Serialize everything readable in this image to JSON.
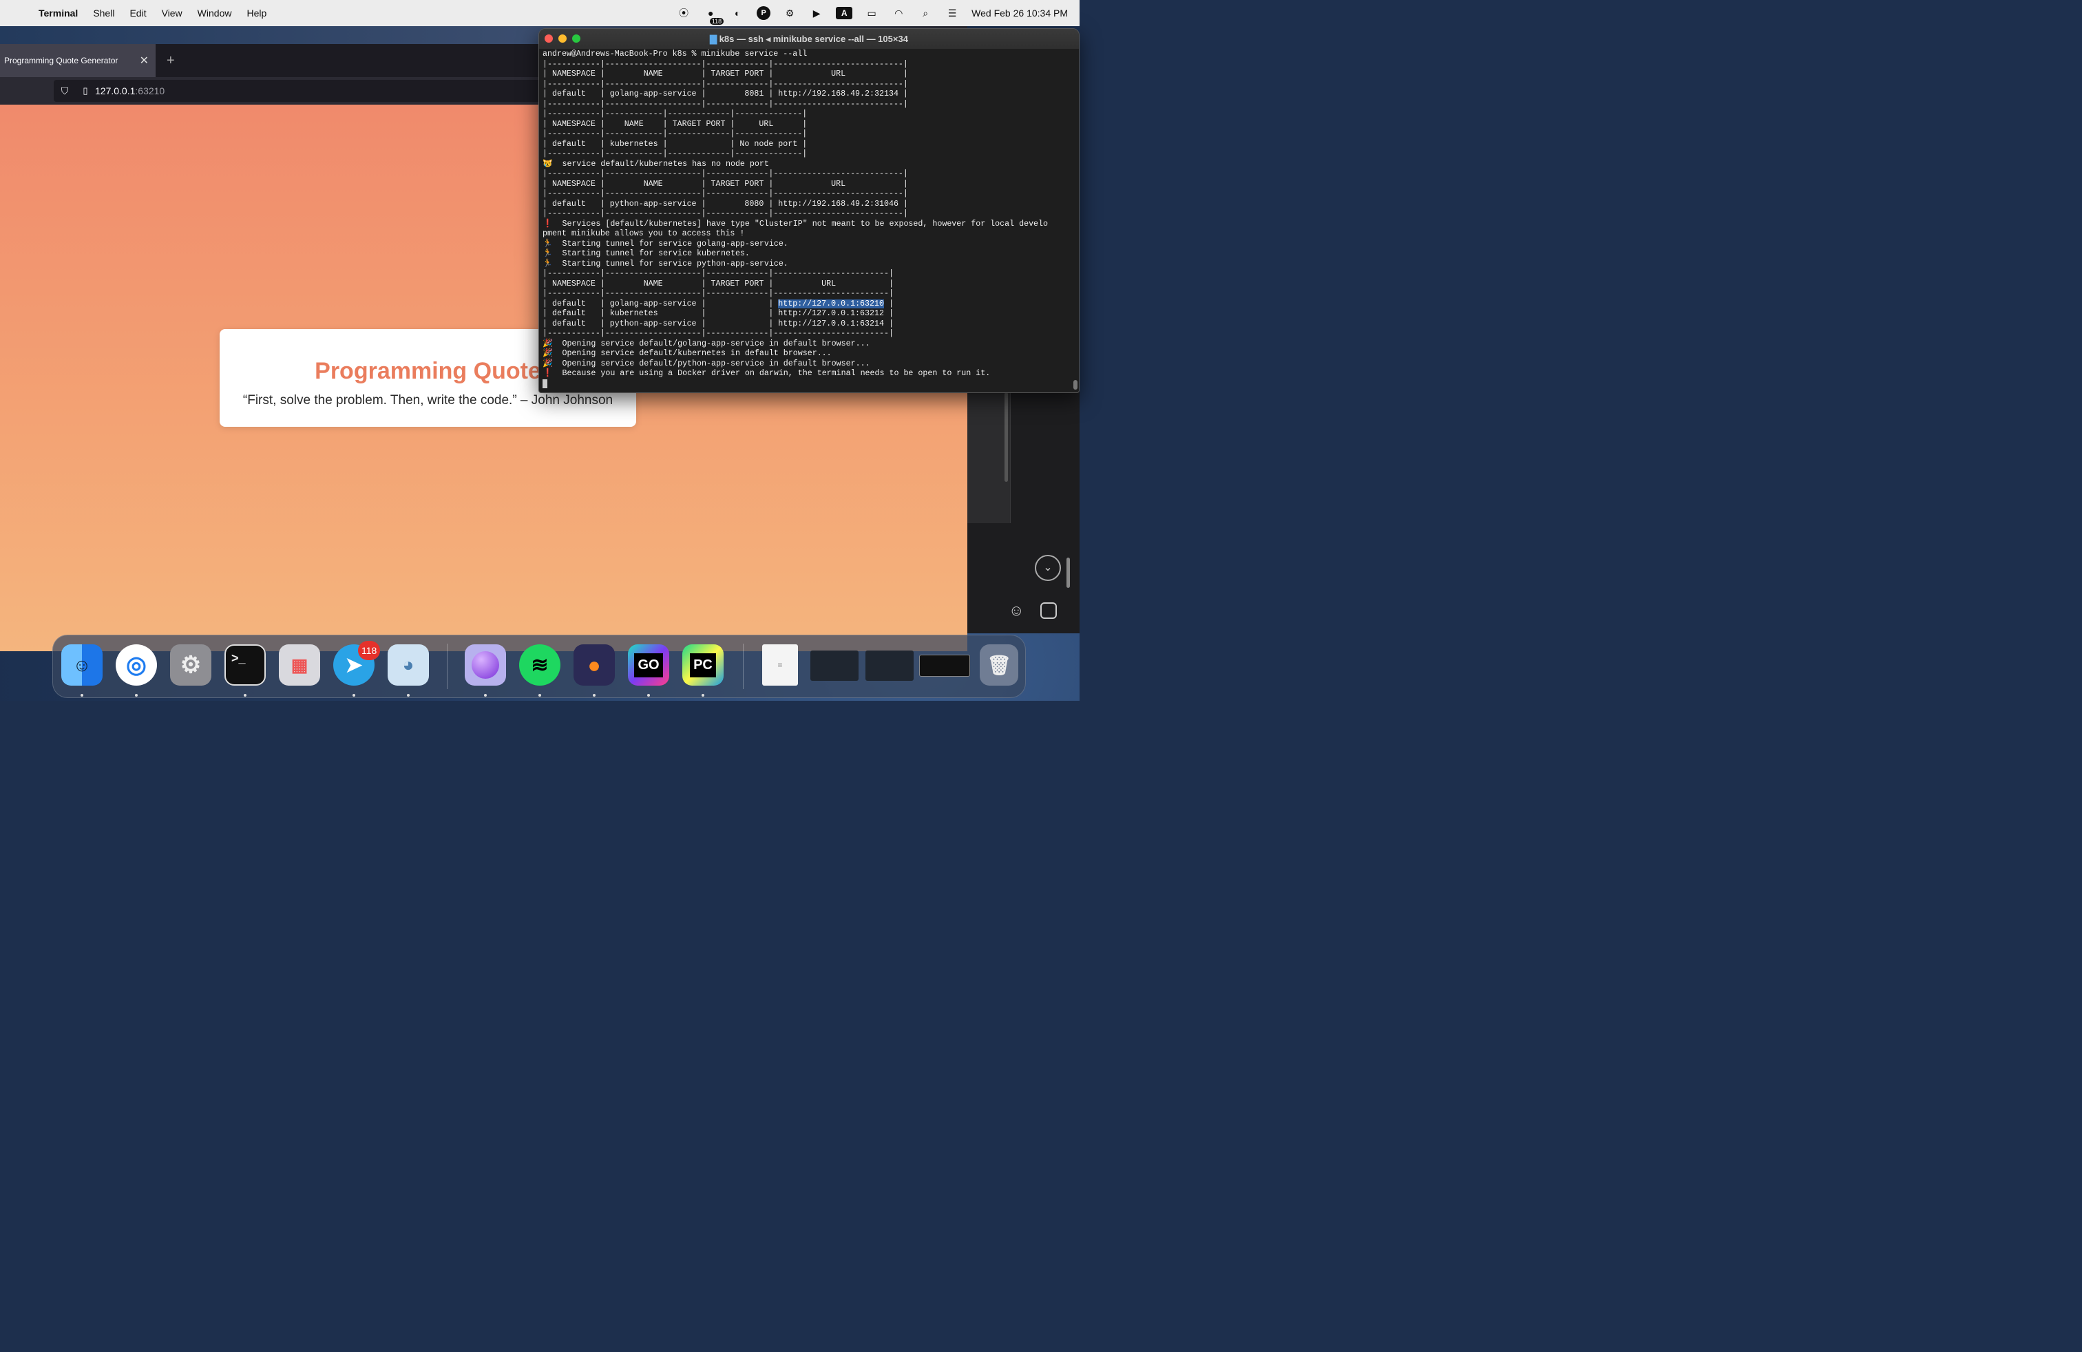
{
  "menubar": {
    "app_name": "Terminal",
    "menus": [
      "Shell",
      "Edit",
      "View",
      "Window",
      "Help"
    ],
    "status_badge": "118",
    "keyboard_label": "A",
    "clock": "Wed Feb 26  10:34 PM"
  },
  "browser": {
    "tab_title": "Programming Quote Generator",
    "url_host": "127.0.0.1",
    "url_port": ":63210",
    "page_heading": "Programming Quote",
    "quote": "“First, solve the problem. Then, write the code.” – John Johnson"
  },
  "terminal": {
    "title": "k8s — ssh ◂ minikube service --all — 105×34",
    "lines": {
      "l01": "andrew@Andrews-MacBook-Pro k8s % minikube service --all",
      "l02": "|-----------|--------------------|-------------|---------------------------|",
      "l03": "| NAMESPACE |        NAME        | TARGET PORT |            URL            |",
      "l04": "|-----------|--------------------|-------------|---------------------------|",
      "l05": "| default   | golang-app-service |        8081 | http://192.168.49.2:32134 |",
      "l06": "|-----------|--------------------|-------------|---------------------------|",
      "l07": "|-----------|------------|-------------|--------------|",
      "l08": "| NAMESPACE |    NAME    | TARGET PORT |     URL      |",
      "l09": "|-----------|------------|-------------|--------------|",
      "l10": "| default   | kubernetes |             | No node port |",
      "l11": "|-----------|------------|-------------|--------------|",
      "l12": "😿  service default/kubernetes has no node port",
      "l13": "|-----------|--------------------|-------------|---------------------------|",
      "l14": "| NAMESPACE |        NAME        | TARGET PORT |            URL            |",
      "l15": "|-----------|--------------------|-------------|---------------------------|",
      "l16": "| default   | python-app-service |        8080 | http://192.168.49.2:31046 |",
      "l17": "|-----------|--------------------|-------------|---------------------------|",
      "l18_icon": "❗",
      "l18": "  Services [default/kubernetes] have type \"ClusterIP\" not meant to be exposed, however for local develo",
      "l19": "pment minikube allows you to access this !",
      "l20": "🏃  Starting tunnel for service golang-app-service.",
      "l21": "🏃  Starting tunnel for service kubernetes.",
      "l22": "🏃  Starting tunnel for service python-app-service.",
      "l23": "|-----------|--------------------|-------------|------------------------|",
      "l24": "| NAMESPACE |        NAME        | TARGET PORT |          URL           |",
      "l25": "|-----------|--------------------|-------------|------------------------|",
      "l26a": "| default   | golang-app-service |             | ",
      "l26b": "http://127.0.0.1:63210",
      "l26c": " |",
      "l27": "| default   | kubernetes         |             | http://127.0.0.1:63212 |",
      "l28": "| default   | python-app-service |             | http://127.0.0.1:63214 |",
      "l29": "|-----------|--------------------|-------------|------------------------|",
      "l30": "🎉  Opening service default/golang-app-service in default browser...",
      "l31": "🎉  Opening service default/kubernetes in default browser...",
      "l32": "🎉  Opening service default/python-app-service in default browser...",
      "l33_icon": "❗",
      "l33": "  Because you are using a Docker driver on darwin, the terminal needs to be open to run it."
    }
  },
  "dock": {
    "telegram_badge": "118",
    "goland_label": "GO",
    "pycharm_label": "PC",
    "terminal_label": ">_"
  }
}
